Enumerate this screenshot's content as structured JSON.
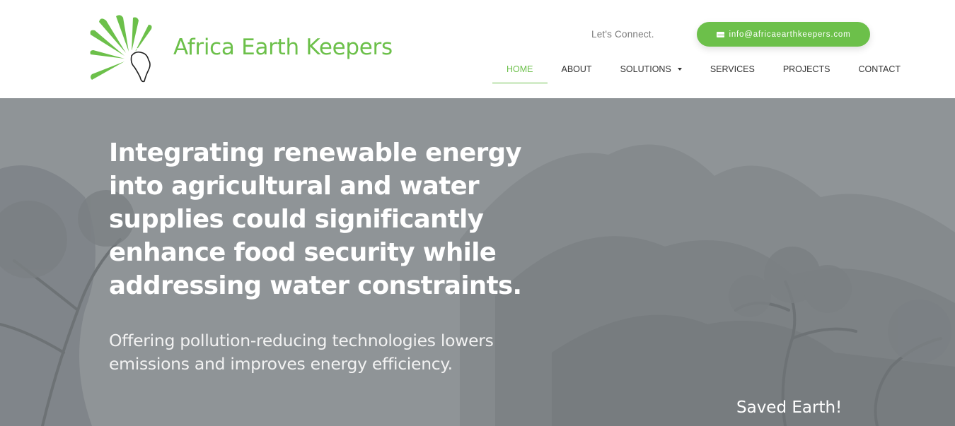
{
  "brand": {
    "name": "Africa Earth Keepers",
    "logo_icon": "africa-sunburst-logo",
    "accent_color": "#6cc04a"
  },
  "header": {
    "connect_label": "Let's Connect.",
    "email": {
      "icon": "envelope-icon",
      "label": "info@africaearthkeepers.com"
    }
  },
  "nav": {
    "items": [
      {
        "label": "HOME",
        "active": true
      },
      {
        "label": "ABOUT"
      },
      {
        "label": "SOLUTIONS",
        "dropdown": true
      },
      {
        "label": "SERVICES"
      },
      {
        "label": "PROJECTS"
      },
      {
        "label": "CONTACT"
      }
    ]
  },
  "hero": {
    "headline": "Integrating renewable energy into agricultural and water supplies could significantly enhance food security while addressing water constraints.",
    "subheadline": "Offering pollution-reducing technologies lowers emissions and improves energy efficiency.",
    "caption": "Saved Earth!",
    "overlay_color": "#8f9497"
  }
}
